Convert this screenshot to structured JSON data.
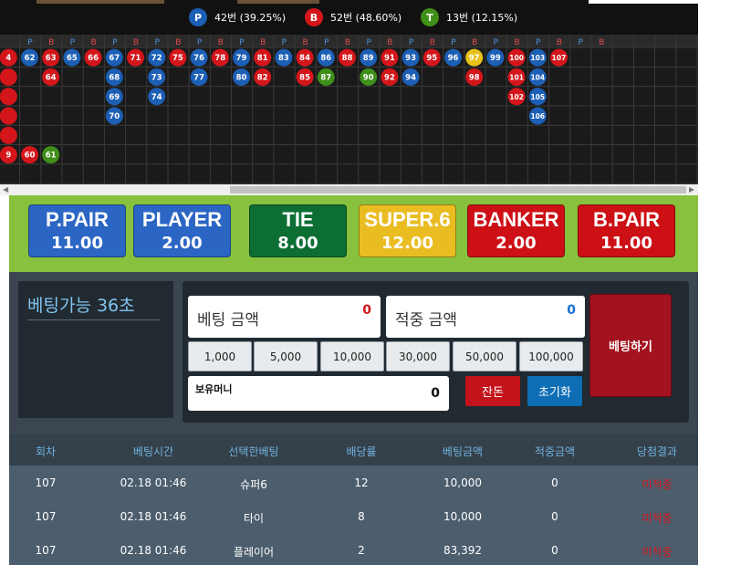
{
  "stats": {
    "player": {
      "badge": "P",
      "text": "42번 (39.25%)"
    },
    "banker": {
      "badge": "B",
      "text": "52번 (48.60%)"
    },
    "tie": {
      "badge": "T",
      "text": "13번 (12.15%)"
    }
  },
  "road": {
    "header_pattern": [
      "P",
      "B",
      "P",
      "B",
      "P",
      "B",
      "P",
      "B",
      "P",
      "B",
      "P",
      "B",
      "P",
      "B",
      "P",
      "B",
      "P",
      "B",
      "P",
      "B",
      "P",
      "B",
      "P",
      "B",
      "P",
      "B",
      "P",
      "B"
    ],
    "columns": [
      {
        "col": -1,
        "beads": [
          {
            "n": "4",
            "t": "B"
          },
          {
            "n": "",
            "t": "B"
          },
          {
            "n": "",
            "t": "B"
          },
          {
            "n": "",
            "t": "B"
          },
          {
            "n": "",
            "t": "B"
          },
          {
            "n": "9",
            "t": "B"
          }
        ]
      },
      {
        "col": 0,
        "beads": [
          {
            "n": "62",
            "t": "P"
          },
          {
            "n": "",
            "t": ""
          },
          {
            "n": "",
            "t": ""
          },
          {
            "n": "",
            "t": ""
          },
          {
            "n": "",
            "t": ""
          },
          {
            "n": "60",
            "t": "B"
          }
        ]
      },
      {
        "col": 1,
        "beads": [
          {
            "n": "63",
            "t": "B"
          },
          {
            "n": "64",
            "t": "B"
          },
          {
            "n": "",
            "t": ""
          },
          {
            "n": "",
            "t": ""
          },
          {
            "n": "",
            "t": ""
          },
          {
            "n": "61",
            "t": "T"
          }
        ]
      },
      {
        "col": 2,
        "beads": [
          {
            "n": "65",
            "t": "P"
          }
        ]
      },
      {
        "col": 3,
        "beads": [
          {
            "n": "66",
            "t": "B"
          }
        ]
      },
      {
        "col": 4,
        "beads": [
          {
            "n": "67",
            "t": "P"
          },
          {
            "n": "68",
            "t": "P"
          },
          {
            "n": "69",
            "t": "P"
          },
          {
            "n": "70",
            "t": "P"
          }
        ]
      },
      {
        "col": 5,
        "beads": [
          {
            "n": "71",
            "t": "B"
          }
        ]
      },
      {
        "col": 6,
        "beads": [
          {
            "n": "72",
            "t": "P"
          },
          {
            "n": "73",
            "t": "P"
          },
          {
            "n": "74",
            "t": "P"
          }
        ]
      },
      {
        "col": 7,
        "beads": [
          {
            "n": "75",
            "t": "B"
          }
        ]
      },
      {
        "col": 8,
        "beads": [
          {
            "n": "76",
            "t": "P"
          },
          {
            "n": "77",
            "t": "P"
          }
        ]
      },
      {
        "col": 9,
        "beads": [
          {
            "n": "78",
            "t": "B"
          }
        ]
      },
      {
        "col": 10,
        "beads": [
          {
            "n": "79",
            "t": "P"
          },
          {
            "n": "80",
            "t": "P"
          }
        ]
      },
      {
        "col": 11,
        "beads": [
          {
            "n": "81",
            "t": "B"
          },
          {
            "n": "82",
            "t": "B"
          }
        ]
      },
      {
        "col": 12,
        "beads": [
          {
            "n": "83",
            "t": "P"
          }
        ]
      },
      {
        "col": 13,
        "beads": [
          {
            "n": "84",
            "t": "B"
          },
          {
            "n": "85",
            "t": "B"
          }
        ]
      },
      {
        "col": 14,
        "beads": [
          {
            "n": "86",
            "t": "P"
          },
          {
            "n": "87",
            "t": "T"
          }
        ]
      },
      {
        "col": 15,
        "beads": [
          {
            "n": "88",
            "t": "B"
          }
        ]
      },
      {
        "col": 16,
        "beads": [
          {
            "n": "89",
            "t": "P"
          },
          {
            "n": "90",
            "t": "T"
          }
        ]
      },
      {
        "col": 17,
        "beads": [
          {
            "n": "91",
            "t": "B"
          },
          {
            "n": "92",
            "t": "B"
          }
        ]
      },
      {
        "col": 18,
        "beads": [
          {
            "n": "93",
            "t": "P"
          },
          {
            "n": "94",
            "t": "P"
          }
        ]
      },
      {
        "col": 19,
        "beads": [
          {
            "n": "95",
            "t": "B"
          }
        ]
      },
      {
        "col": 20,
        "beads": [
          {
            "n": "96",
            "t": "P"
          }
        ]
      },
      {
        "col": 21,
        "beads": [
          {
            "n": "97",
            "t": "S"
          },
          {
            "n": "98",
            "t": "B"
          }
        ]
      },
      {
        "col": 22,
        "beads": [
          {
            "n": "99",
            "t": "P"
          }
        ]
      },
      {
        "col": 23,
        "beads": [
          {
            "n": "100",
            "t": "B"
          },
          {
            "n": "101",
            "t": "B"
          },
          {
            "n": "102",
            "t": "B"
          }
        ]
      },
      {
        "col": 24,
        "beads": [
          {
            "n": "103",
            "t": "P"
          },
          {
            "n": "104",
            "t": "P"
          },
          {
            "n": "105",
            "t": "P"
          },
          {
            "n": "106",
            "t": "P"
          }
        ]
      },
      {
        "col": 25,
        "beads": [
          {
            "n": "107",
            "t": "B"
          }
        ]
      }
    ]
  },
  "bet_options": [
    {
      "name": "P.PAIR",
      "odds": "11.00",
      "color": "#2b66c4"
    },
    {
      "name": "PLAYER",
      "odds": "2.00",
      "color": "#2b66c4"
    },
    {
      "name": "TIE",
      "odds": "8.00",
      "color": "#0d6e34"
    },
    {
      "name": "SUPER.6",
      "odds": "12.00",
      "color": "#e9bd22"
    },
    {
      "name": "BANKER",
      "odds": "2.00",
      "color": "#cc1015"
    },
    {
      "name": "B.PAIR",
      "odds": "11.00",
      "color": "#cc1015"
    }
  ],
  "control": {
    "timer": "베팅가능 36초",
    "bet_amount_label": "베팅 금액",
    "bet_amount_value": "0",
    "win_amount_label": "적중 금액",
    "win_amount_value": "0",
    "chips": [
      "1,000",
      "5,000",
      "10,000",
      "30,000",
      "50,000",
      "100,000"
    ],
    "holding_label": "보유머니",
    "holding_value": "0",
    "remainder_button": "잔돈",
    "reset_button": "초기화",
    "place_bet_button": "베팅하기"
  },
  "history": {
    "headers": [
      "회차",
      "베팅시간",
      "선택한베팅",
      "배당률",
      "베팅금액",
      "적중금액",
      "당첨결과"
    ],
    "rows": [
      [
        "107",
        "02.18 01:46",
        "슈퍼6",
        "12",
        "10,000",
        "0",
        "미적중"
      ],
      [
        "107",
        "02.18 01:46",
        "타이",
        "8",
        "10,000",
        "0",
        "미적중"
      ],
      [
        "107",
        "02.18 01:46",
        "플레이어",
        "2",
        "83,392",
        "0",
        "미적중"
      ]
    ]
  },
  "colors": {
    "player": "#1c5fb5",
    "banker": "#d4161b",
    "tie": "#3f8f19",
    "super6": "#e8c21a",
    "result_miss": "#d4161b"
  }
}
